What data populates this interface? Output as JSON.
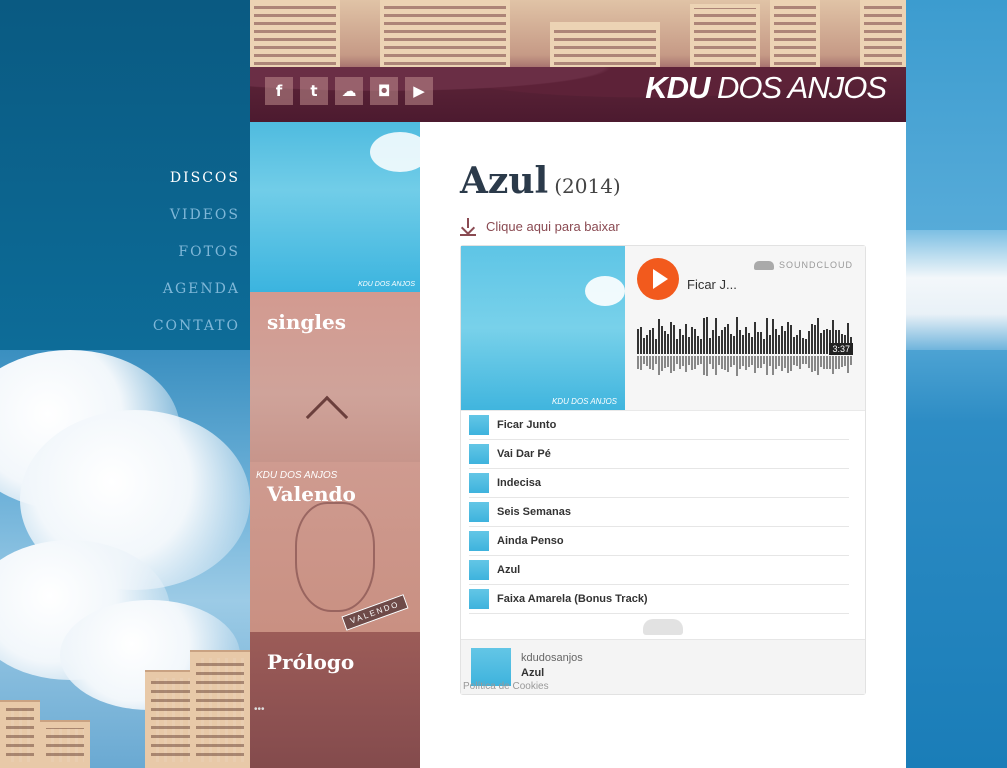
{
  "nav": {
    "items": [
      {
        "label": "DISCOS",
        "active": true
      },
      {
        "label": "VIDEOS"
      },
      {
        "label": "FOTOS"
      },
      {
        "label": "AGENDA"
      },
      {
        "label": "CONTATO"
      }
    ]
  },
  "header": {
    "logo_bold": "KDU",
    "logo_light": "DOS ANJOS",
    "social": [
      "facebook-icon",
      "twitter-icon",
      "soundcloud-icon",
      "instagram-icon",
      "youtube-icon"
    ]
  },
  "albums": {
    "cover_small_text": "KDU DOS ANJOS",
    "singles": "singles",
    "valendo": "Valendo",
    "valendo_sub": "KDU DOS ANJOS",
    "valendo_stamp": "VALENDO",
    "prologo": "Prólogo"
  },
  "main": {
    "album_title": "Azul",
    "album_year": "(2014)",
    "download_label": "Clique aqui para baixar"
  },
  "player": {
    "brand": "SOUNDCLOUD",
    "now_playing": "Ficar J...",
    "duration": "3:37",
    "art_text": "KDU DOS ANJOS",
    "tracks": [
      "Ficar Junto",
      "Vai Dar Pé",
      "Indecisa",
      "Seis Semanas",
      "Ainda Penso",
      "Azul",
      "Faixa Amarela (Bonus Track)"
    ],
    "footer_user": "kdudosanjos",
    "footer_playlist": "Azul",
    "cookies": "Política de Cookies"
  },
  "colors": {
    "accent": "#f25a1d",
    "title": "#2b3a4a",
    "download": "#8a4a52"
  }
}
